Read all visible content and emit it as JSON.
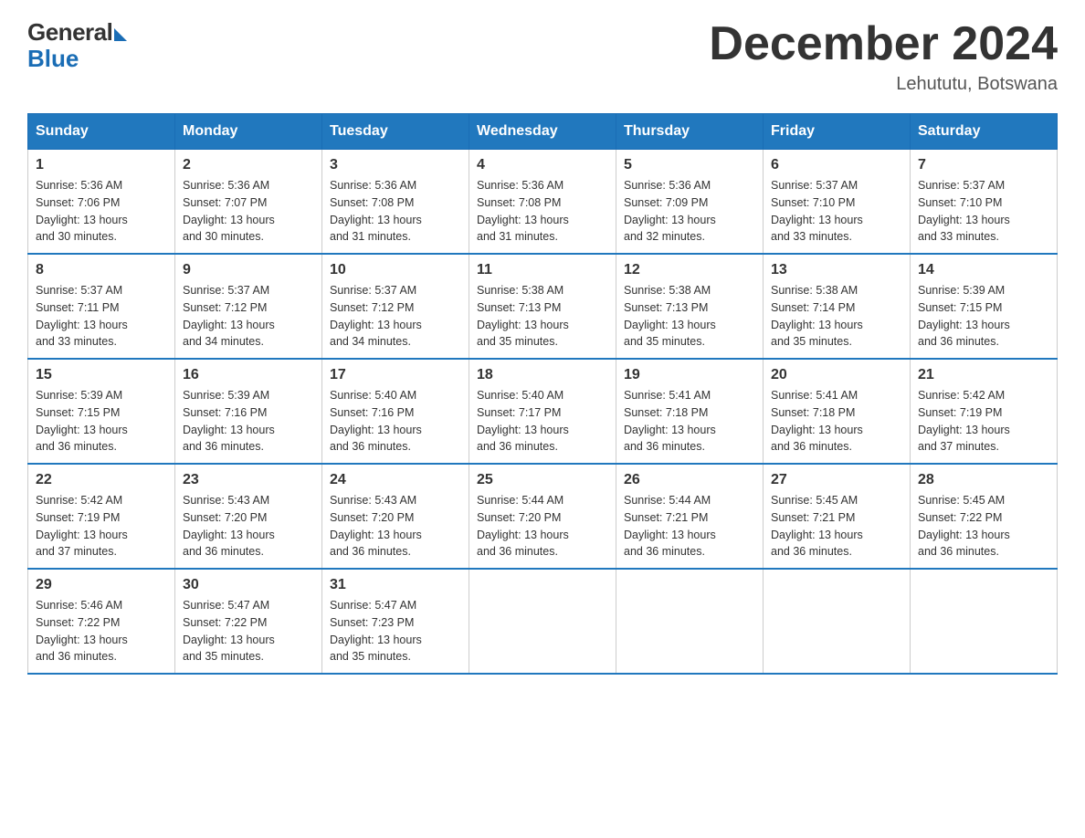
{
  "logo": {
    "general": "General",
    "blue": "Blue"
  },
  "title": "December 2024",
  "location": "Lehututu, Botswana",
  "days_header": [
    "Sunday",
    "Monday",
    "Tuesday",
    "Wednesday",
    "Thursday",
    "Friday",
    "Saturday"
  ],
  "weeks": [
    [
      {
        "day": "1",
        "sunrise": "5:36 AM",
        "sunset": "7:06 PM",
        "daylight": "13 hours and 30 minutes."
      },
      {
        "day": "2",
        "sunrise": "5:36 AM",
        "sunset": "7:07 PM",
        "daylight": "13 hours and 30 minutes."
      },
      {
        "day": "3",
        "sunrise": "5:36 AM",
        "sunset": "7:08 PM",
        "daylight": "13 hours and 31 minutes."
      },
      {
        "day": "4",
        "sunrise": "5:36 AM",
        "sunset": "7:08 PM",
        "daylight": "13 hours and 31 minutes."
      },
      {
        "day": "5",
        "sunrise": "5:36 AM",
        "sunset": "7:09 PM",
        "daylight": "13 hours and 32 minutes."
      },
      {
        "day": "6",
        "sunrise": "5:37 AM",
        "sunset": "7:10 PM",
        "daylight": "13 hours and 33 minutes."
      },
      {
        "day": "7",
        "sunrise": "5:37 AM",
        "sunset": "7:10 PM",
        "daylight": "13 hours and 33 minutes."
      }
    ],
    [
      {
        "day": "8",
        "sunrise": "5:37 AM",
        "sunset": "7:11 PM",
        "daylight": "13 hours and 33 minutes."
      },
      {
        "day": "9",
        "sunrise": "5:37 AM",
        "sunset": "7:12 PM",
        "daylight": "13 hours and 34 minutes."
      },
      {
        "day": "10",
        "sunrise": "5:37 AM",
        "sunset": "7:12 PM",
        "daylight": "13 hours and 34 minutes."
      },
      {
        "day": "11",
        "sunrise": "5:38 AM",
        "sunset": "7:13 PM",
        "daylight": "13 hours and 35 minutes."
      },
      {
        "day": "12",
        "sunrise": "5:38 AM",
        "sunset": "7:13 PM",
        "daylight": "13 hours and 35 minutes."
      },
      {
        "day": "13",
        "sunrise": "5:38 AM",
        "sunset": "7:14 PM",
        "daylight": "13 hours and 35 minutes."
      },
      {
        "day": "14",
        "sunrise": "5:39 AM",
        "sunset": "7:15 PM",
        "daylight": "13 hours and 36 minutes."
      }
    ],
    [
      {
        "day": "15",
        "sunrise": "5:39 AM",
        "sunset": "7:15 PM",
        "daylight": "13 hours and 36 minutes."
      },
      {
        "day": "16",
        "sunrise": "5:39 AM",
        "sunset": "7:16 PM",
        "daylight": "13 hours and 36 minutes."
      },
      {
        "day": "17",
        "sunrise": "5:40 AM",
        "sunset": "7:16 PM",
        "daylight": "13 hours and 36 minutes."
      },
      {
        "day": "18",
        "sunrise": "5:40 AM",
        "sunset": "7:17 PM",
        "daylight": "13 hours and 36 minutes."
      },
      {
        "day": "19",
        "sunrise": "5:41 AM",
        "sunset": "7:18 PM",
        "daylight": "13 hours and 36 minutes."
      },
      {
        "day": "20",
        "sunrise": "5:41 AM",
        "sunset": "7:18 PM",
        "daylight": "13 hours and 36 minutes."
      },
      {
        "day": "21",
        "sunrise": "5:42 AM",
        "sunset": "7:19 PM",
        "daylight": "13 hours and 37 minutes."
      }
    ],
    [
      {
        "day": "22",
        "sunrise": "5:42 AM",
        "sunset": "7:19 PM",
        "daylight": "13 hours and 37 minutes."
      },
      {
        "day": "23",
        "sunrise": "5:43 AM",
        "sunset": "7:20 PM",
        "daylight": "13 hours and 36 minutes."
      },
      {
        "day": "24",
        "sunrise": "5:43 AM",
        "sunset": "7:20 PM",
        "daylight": "13 hours and 36 minutes."
      },
      {
        "day": "25",
        "sunrise": "5:44 AM",
        "sunset": "7:20 PM",
        "daylight": "13 hours and 36 minutes."
      },
      {
        "day": "26",
        "sunrise": "5:44 AM",
        "sunset": "7:21 PM",
        "daylight": "13 hours and 36 minutes."
      },
      {
        "day": "27",
        "sunrise": "5:45 AM",
        "sunset": "7:21 PM",
        "daylight": "13 hours and 36 minutes."
      },
      {
        "day": "28",
        "sunrise": "5:45 AM",
        "sunset": "7:22 PM",
        "daylight": "13 hours and 36 minutes."
      }
    ],
    [
      {
        "day": "29",
        "sunrise": "5:46 AM",
        "sunset": "7:22 PM",
        "daylight": "13 hours and 36 minutes."
      },
      {
        "day": "30",
        "sunrise": "5:47 AM",
        "sunset": "7:22 PM",
        "daylight": "13 hours and 35 minutes."
      },
      {
        "day": "31",
        "sunrise": "5:47 AM",
        "sunset": "7:23 PM",
        "daylight": "13 hours and 35 minutes."
      },
      null,
      null,
      null,
      null
    ]
  ],
  "labels": {
    "sunrise_prefix": "Sunrise: ",
    "sunset_prefix": "Sunset: ",
    "daylight_prefix": "Daylight: "
  }
}
